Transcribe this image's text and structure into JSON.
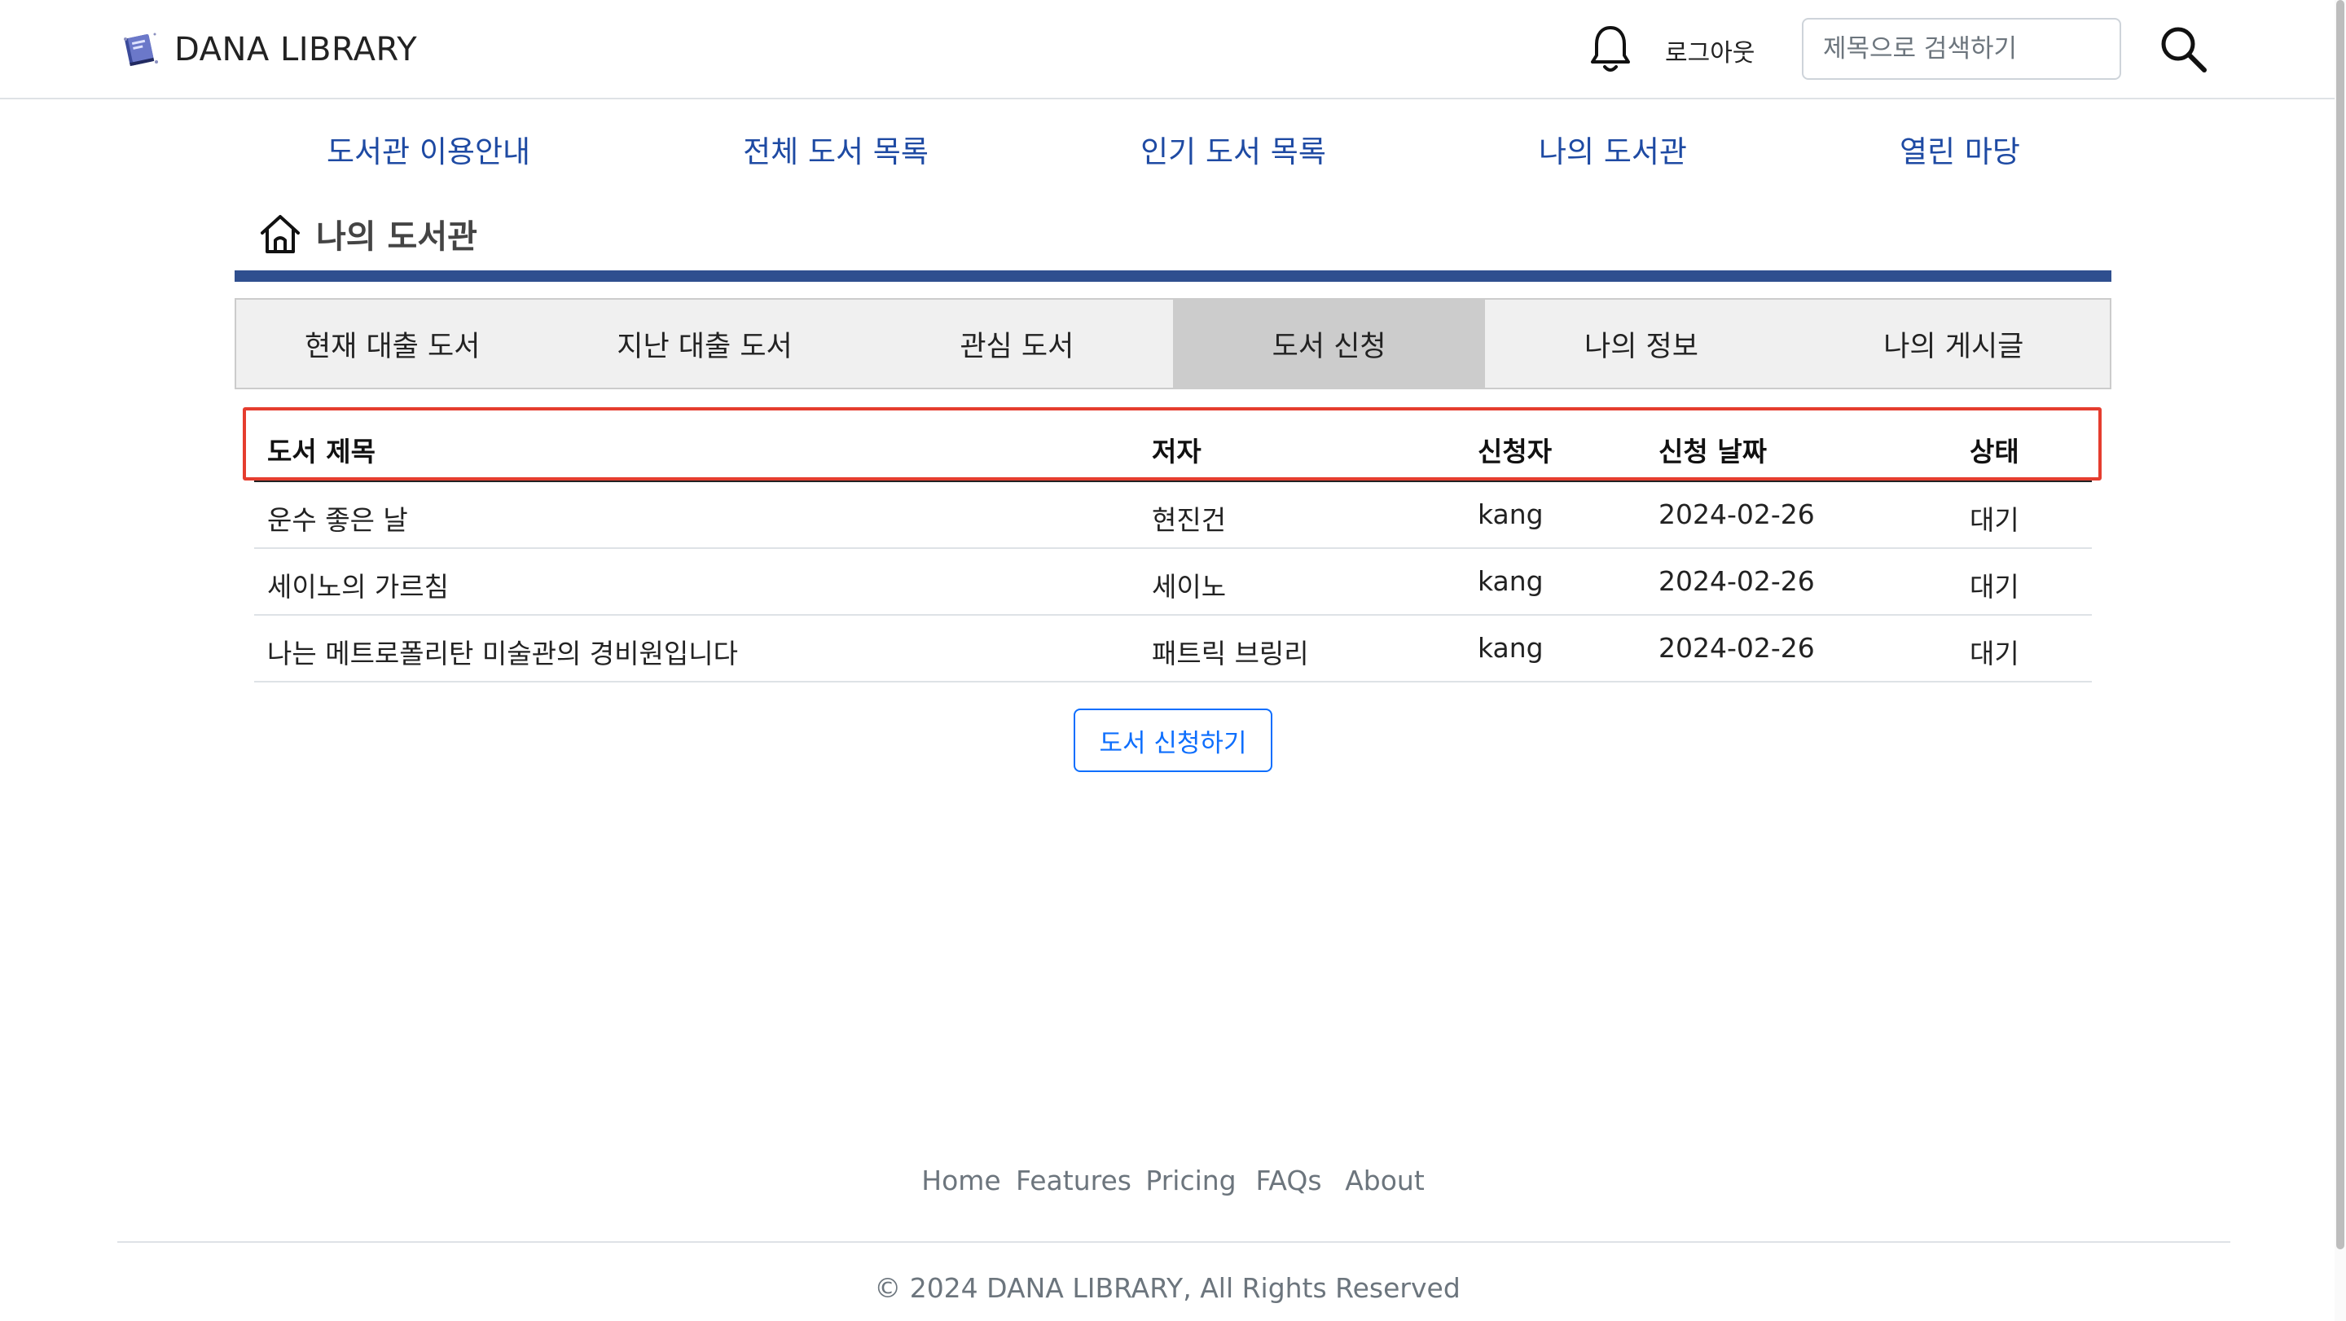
{
  "header": {
    "brand": "DANA LIBRARY",
    "logout_label": "로그아웃",
    "search_placeholder": "제목으로 검색하기",
    "icons": {
      "logo": "book-logo-icon",
      "bell": "bell-icon",
      "search": "search-icon"
    }
  },
  "nav": {
    "items": [
      "도서관 이용안내",
      "전체 도서 목록",
      "인기 도서 목록",
      "나의 도서관",
      "열린 마당"
    ]
  },
  "page": {
    "title": "나의 도서관",
    "title_icon": "home-icon",
    "accent_color": "#2f4f8f"
  },
  "tabs": {
    "items": [
      "현재 대출 도서",
      "지난 대출 도서",
      "관심 도서",
      "도서 신청",
      "나의 정보",
      "나의 게시글"
    ],
    "active": "도서 신청"
  },
  "table": {
    "headers": [
      "도서 제목",
      "저자",
      "신청자",
      "신청 날짜",
      "상태"
    ],
    "rows": [
      [
        "운수 좋은 날",
        "현진건",
        "kang",
        "2024-02-26",
        "대기"
      ],
      [
        "세이노의 가르침",
        "세이노",
        "kang",
        "2024-02-26",
        "대기"
      ],
      [
        "나는 메트로폴리탄 미술관의 경비원입니다",
        "패트릭 브링리",
        "kang",
        "2024-02-26",
        "대기"
      ]
    ],
    "highlight_color": "#e53d2f"
  },
  "actions": {
    "request_button": "도서 신청하기"
  },
  "footer": {
    "links": [
      "Home",
      "Features",
      "Pricing",
      "FAQs",
      "About"
    ],
    "copyright": "© 2024 DANA LIBRARY, All Rights Reserved"
  }
}
